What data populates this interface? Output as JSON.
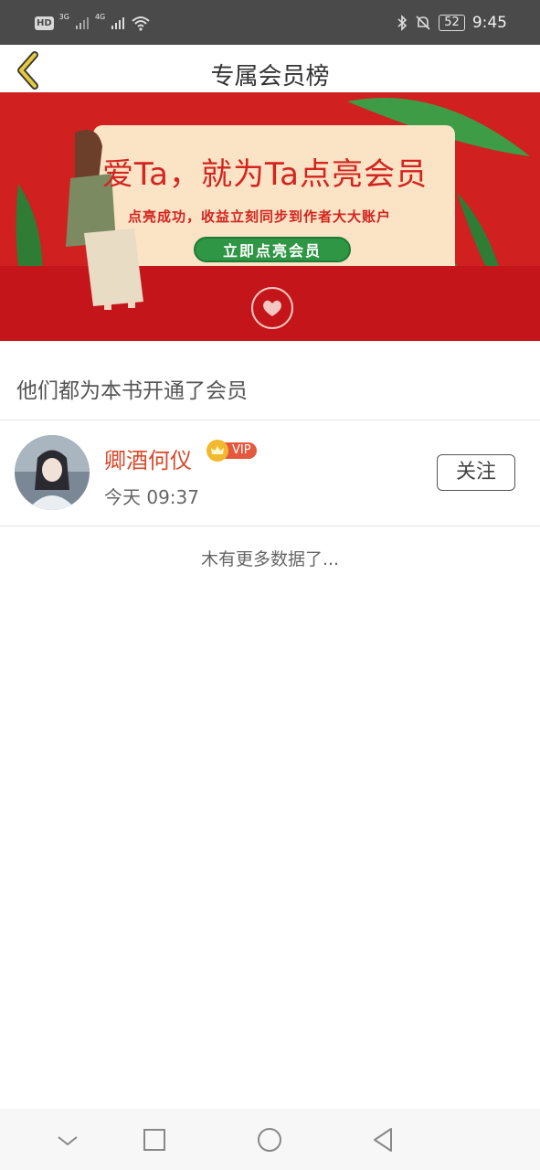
{
  "status_bar": {
    "hd": "HD",
    "net_3g": "3G",
    "net_4g": "4G",
    "battery": "52",
    "time": "9:45"
  },
  "header": {
    "title": "专属会员榜"
  },
  "banner": {
    "title": "爱Ta，就为Ta点亮会员",
    "subtitle": "点亮成功，收益立刻同步到作者大大账户",
    "button": "立即点亮会员"
  },
  "section": {
    "title": "他们都为本书开通了会员"
  },
  "members": [
    {
      "name": "卿酒何仪",
      "badge": "VIP",
      "time": "今天 09:37",
      "follow_label": "关注"
    }
  ],
  "footer": {
    "no_more": "木有更多数据了..."
  },
  "colors": {
    "status_bar": "#4a4a4a",
    "banner_red": "#d0201f",
    "name_red": "#d84a2b",
    "button_green": "#2f9645",
    "back_arrow": "#e8c93a"
  }
}
